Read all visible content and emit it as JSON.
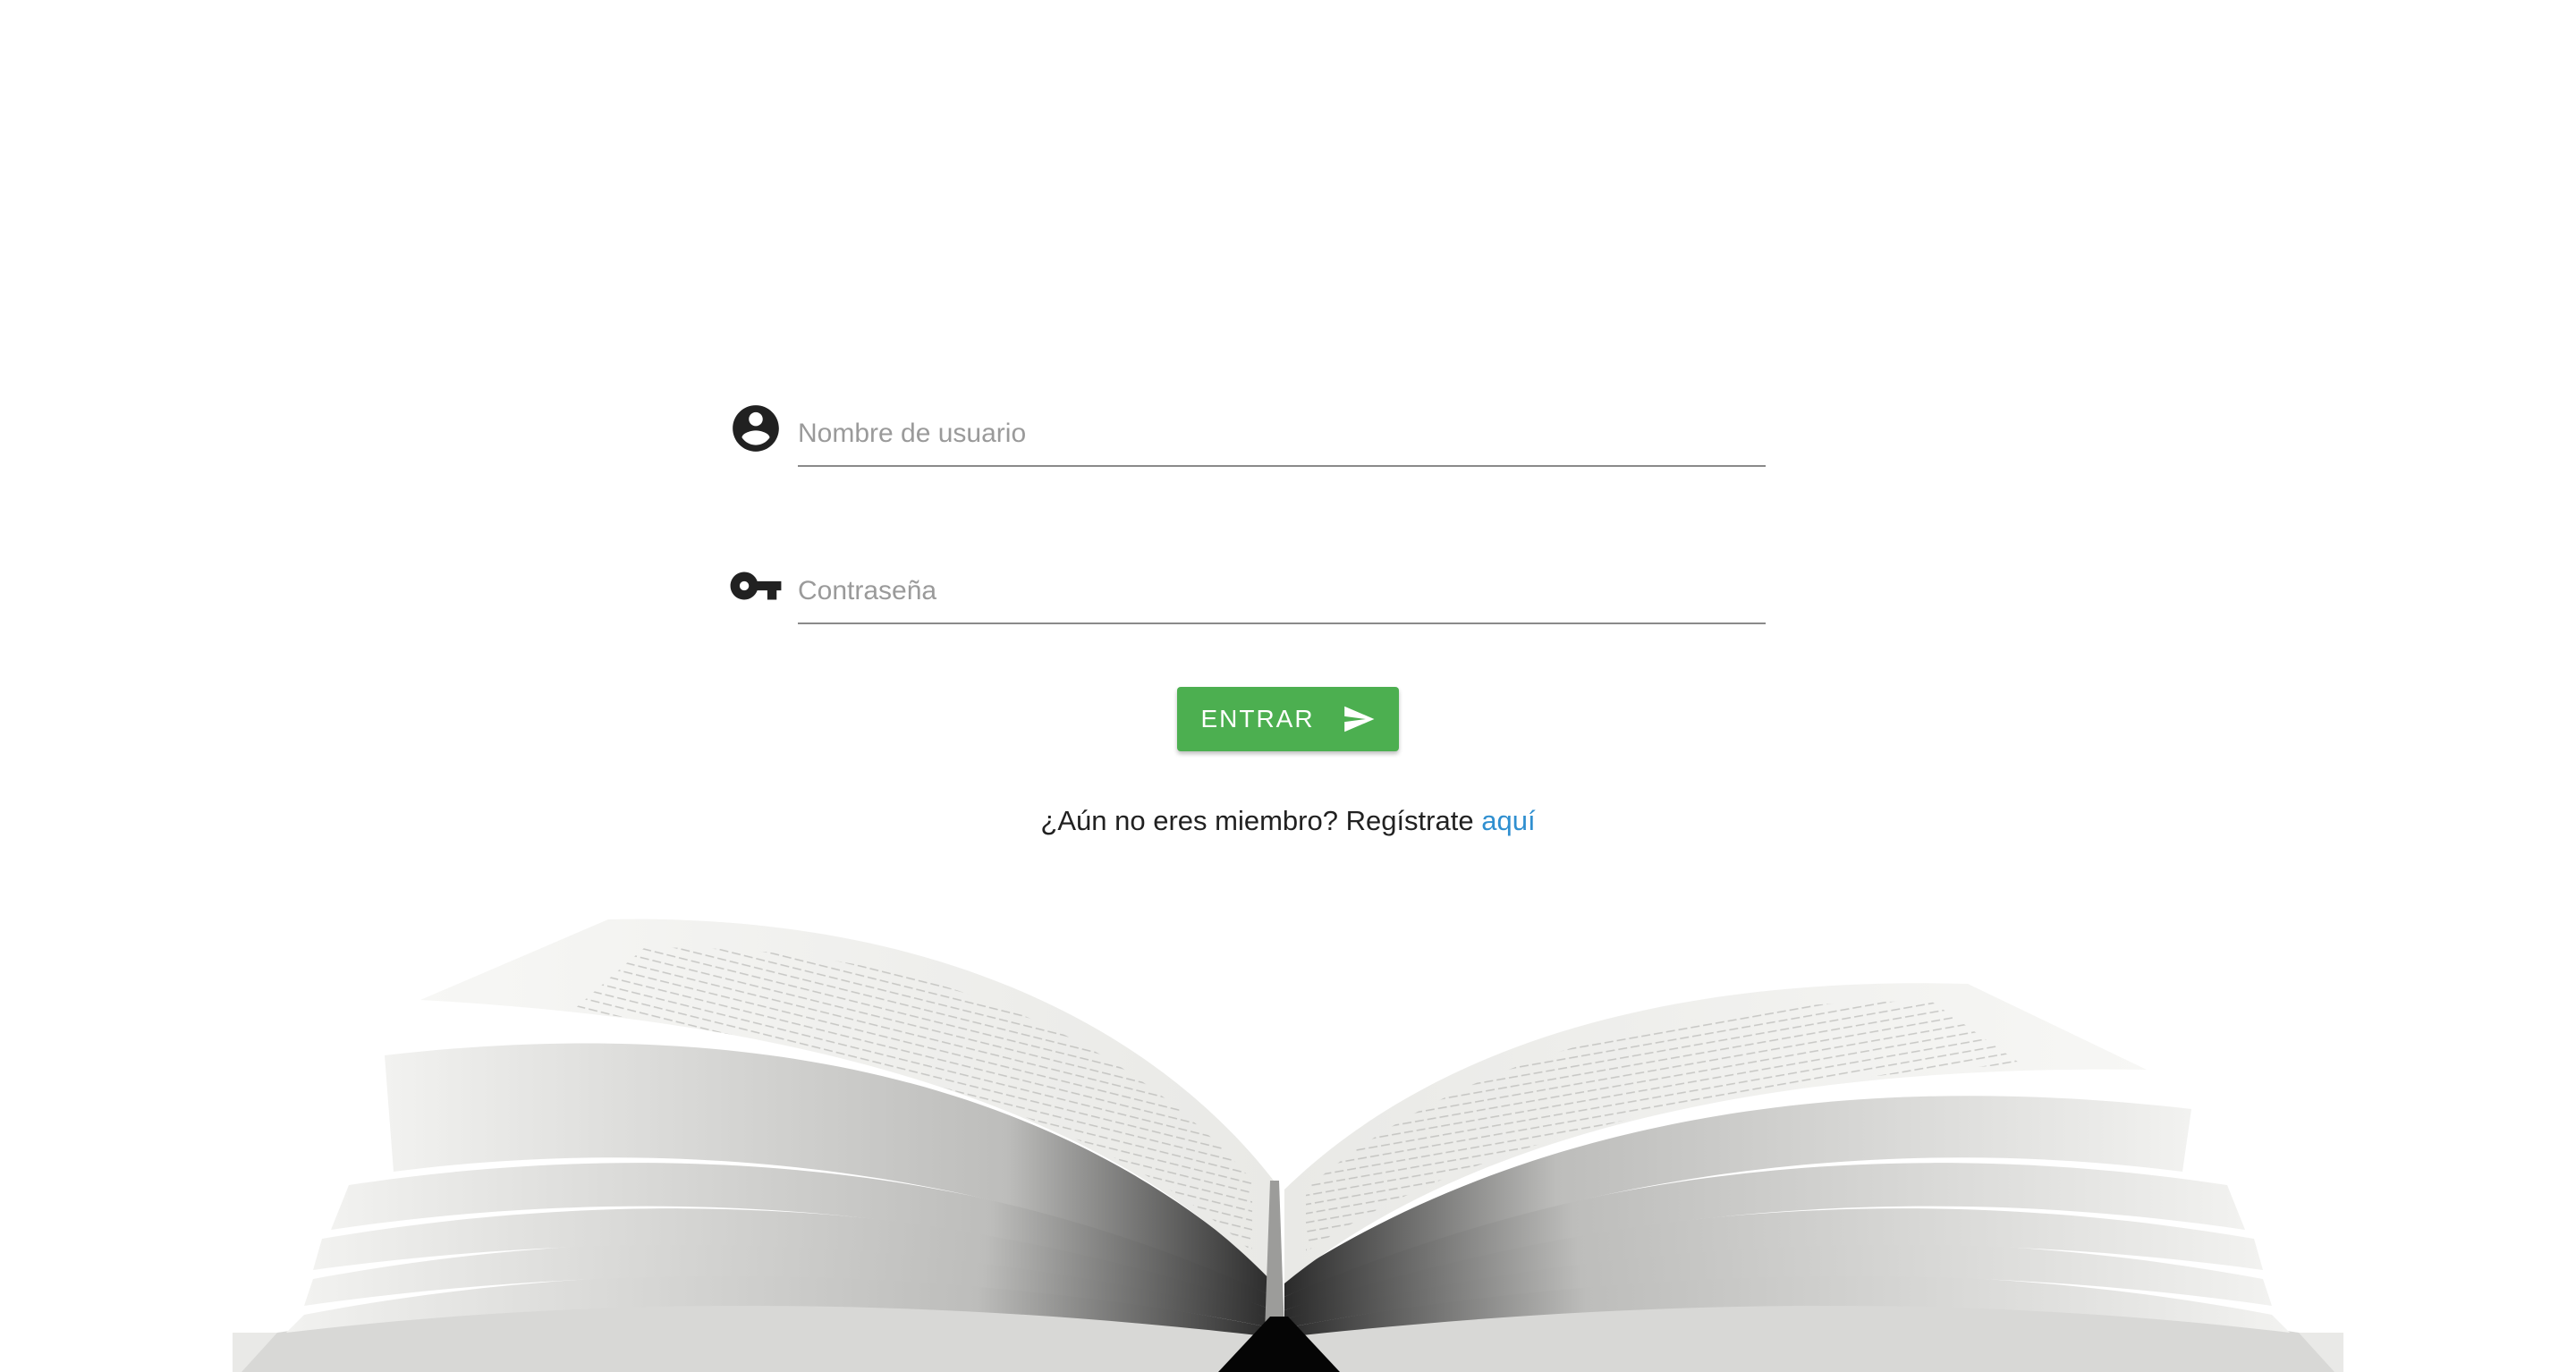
{
  "login": {
    "username_placeholder": "Nombre de usuario",
    "password_placeholder": "Contraseña",
    "submit_label": "ENTRAR"
  },
  "register": {
    "prompt_text": "¿Aún no eres miembro? Regístrate",
    "link_text": "aquí"
  },
  "icons": {
    "username": "account-circle-icon",
    "password": "key-icon",
    "submit": "send-icon"
  },
  "colors": {
    "accent_button": "#4caf50",
    "link": "#2f8fd0",
    "text": "#212121",
    "placeholder": "#9a9a9a"
  }
}
